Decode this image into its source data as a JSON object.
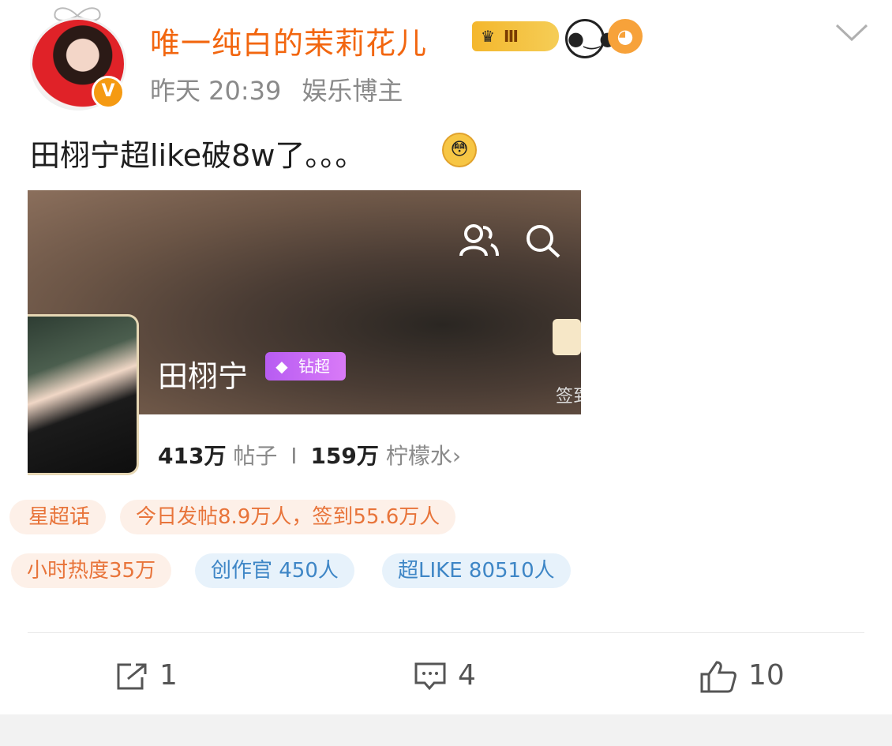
{
  "post": {
    "username": "唯一纯白的茉莉花儿",
    "level_badge": "Ⅲ",
    "verified_badge": "V",
    "time": "昨天 20:39",
    "role": "娱乐博主",
    "text": "田栩宁超like破8w了。。。",
    "emoji": "😳"
  },
  "screenshot": {
    "star_name": "田栩宁",
    "tier_badge": "钻超",
    "checkin_label": "签到",
    "posts_count": "413万",
    "posts_label": "帖子",
    "separator": "I",
    "fans_count": "159万",
    "fans_label": "柠檬水",
    "fans_arrow": "›",
    "pills_row1": [
      "星超话",
      "今日发帖8.9万人，签到55.6万人"
    ],
    "pills_row2": [
      "小时热度35万",
      "创作官 450人",
      "超LIKE 80510人"
    ]
  },
  "actions": {
    "share_count": "1",
    "comment_count": "4",
    "like_count": "10"
  },
  "colors": {
    "username": "#f2660f",
    "pill_orange_text": "#e8743a",
    "pill_blue_text": "#3e86c6"
  }
}
